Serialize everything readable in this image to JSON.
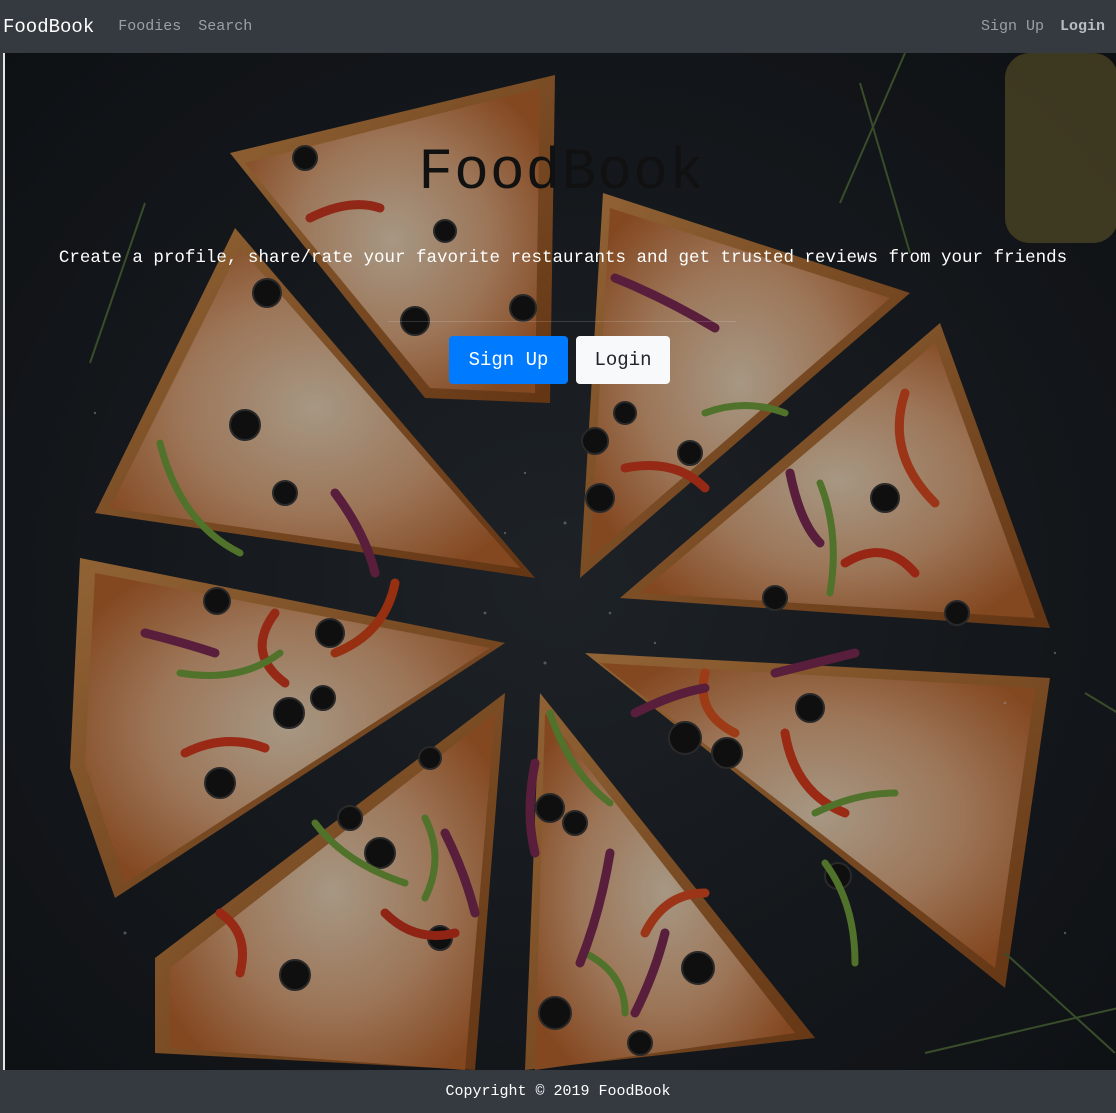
{
  "navbar": {
    "brand": "FoodBook",
    "links": [
      "Foodies",
      "Search"
    ],
    "right_links": [
      "Sign Up",
      "Login"
    ]
  },
  "hero": {
    "title": "FoodBook",
    "subtitle": "Create a profile, share/rate your favorite restaurants and get trusted reviews from your friends",
    "signup_label": "Sign Up",
    "login_label": "Login"
  },
  "footer": {
    "copyright": "Copyright © 2019 FoodBook"
  },
  "colors": {
    "navbar_bg": "#343a40",
    "primary": "#007bff",
    "light": "#f8f9fa"
  },
  "icons": {
    "background": "pizza-image"
  }
}
